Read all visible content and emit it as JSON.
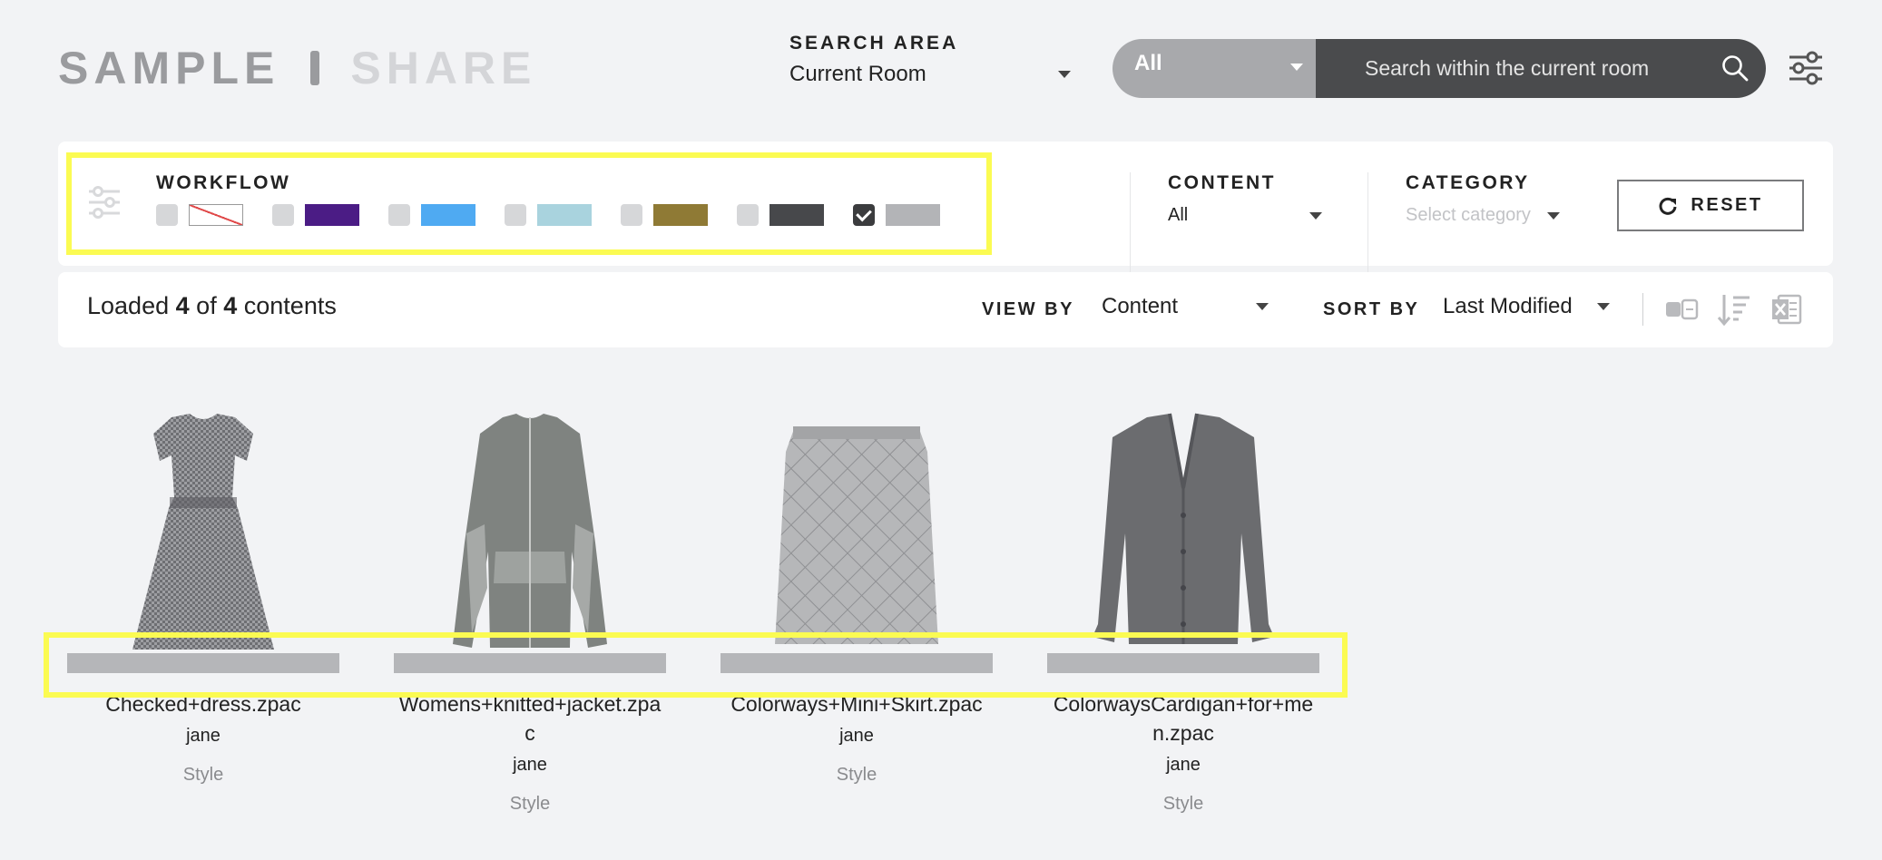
{
  "brand": {
    "part1": "SAMPLE",
    "part2": "SHARE"
  },
  "search_area": {
    "label": "SEARCH AREA",
    "value": "Current Room"
  },
  "search": {
    "scope": "All",
    "placeholder": "Search within the current room"
  },
  "workflow": {
    "title": "WORKFLOW",
    "items": [
      {
        "color": "none",
        "checked": false
      },
      {
        "color": "#4b1c85",
        "checked": false
      },
      {
        "color": "#4faaf2",
        "checked": false
      },
      {
        "color": "#a9d3de",
        "checked": false
      },
      {
        "color": "#8f7a35",
        "checked": false
      },
      {
        "color": "#47484b",
        "checked": false
      },
      {
        "color": "#b3b4b7",
        "checked": true
      }
    ]
  },
  "content_filter": {
    "label": "CONTENT",
    "value": "All"
  },
  "category_filter": {
    "label": "CATEGORY",
    "placeholder": "Select category"
  },
  "reset_label": "RESET",
  "toolbar": {
    "loaded_prefix": "Loaded",
    "loaded_count": "4",
    "loaded_of": "of",
    "loaded_total": "4",
    "loaded_suffix": "contents",
    "view_by_label": "VIEW BY",
    "view_by_value": "Content",
    "sort_by_label": "SORT BY",
    "sort_by_value": "Last Modified"
  },
  "cards": [
    {
      "name": "Checked+dress.zpac",
      "owner": "jane",
      "type": "Style",
      "image": "dress",
      "workflow_color": "#b5b6b9"
    },
    {
      "name": "Womens+knitted+jacket.zpac",
      "owner": "jane",
      "type": "Style",
      "image": "jacket",
      "workflow_color": "#b5b6b9"
    },
    {
      "name": "Colorways+Mini+Skirt.zpac",
      "owner": "jane",
      "type": "Style",
      "image": "skirt",
      "workflow_color": "#b5b6b9"
    },
    {
      "name": "ColorwaysCardigan+for+men.zpac",
      "owner": "jane",
      "type": "Style",
      "image": "cardigan",
      "workflow_color": "#b5b6b9"
    }
  ]
}
